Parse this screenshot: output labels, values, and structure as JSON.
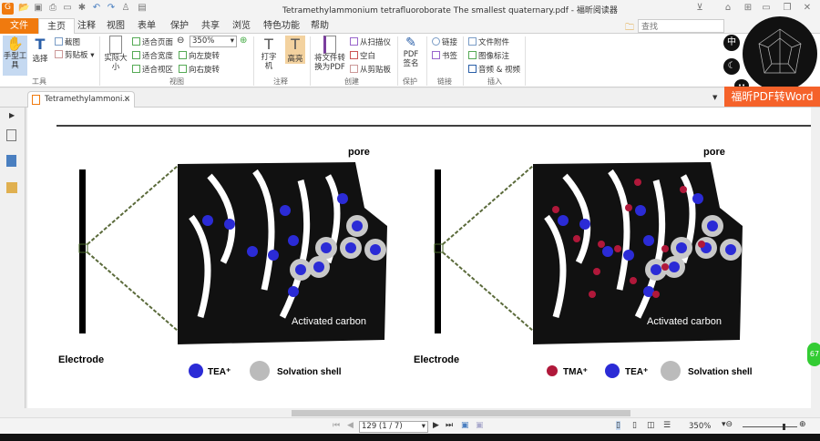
{
  "window": {
    "title": "Tetramethylammonium tetrafluoroborate The smallest quaternary.pdf - 福昕阅读器"
  },
  "menu": [
    "文件",
    "主页",
    "注释",
    "视图",
    "表单",
    "保护",
    "共享",
    "浏览",
    "特色功能",
    "帮助"
  ],
  "search": {
    "placeholder": "查找"
  },
  "ribbon": {
    "tools": {
      "hand": "手型工具",
      "select": "选择",
      "screenshot": "截图",
      "clipboard": "剪贴板",
      "group": "工具"
    },
    "view": {
      "actual": "实际大小",
      "fit_page": "适合页面",
      "fit_width": "适合宽度",
      "fit_visible": "适合视区",
      "zoom": "350%",
      "rotate_left": "向左旋转",
      "rotate_right": "向右旋转",
      "group": "视图"
    },
    "comment": {
      "typewriter": "打字机",
      "highlight": "高亮",
      "group": "注释"
    },
    "create": {
      "convert": "将文件转换为PDF",
      "scanner": "从扫描仪",
      "blank": "空白",
      "from_clipboard": "从剪贴板",
      "group": "创建"
    },
    "protect": {
      "sign": "PDF签名",
      "group": "保护"
    },
    "links": {
      "link": "链接",
      "bookmark": "书签",
      "group": "链接"
    },
    "insert": {
      "attach": "文件附件",
      "image": "图像标注",
      "av": "音频 & 视频",
      "group": "插入"
    }
  },
  "tab": {
    "label": "Tetramethylammoni..."
  },
  "widget": {
    "lang": "中",
    "ad": "福昕PDF转Word",
    "badge": "67"
  },
  "figure": {
    "pore": "pore",
    "carbon": "Activated carbon",
    "electrode": "Electrode",
    "tea": "TEA⁺",
    "tma": "TMA⁺",
    "shell": "Solvation shell"
  },
  "status": {
    "page": "129 (1 / 7)",
    "zoom": "350%",
    "zoom_level": 0.75
  },
  "colors": {
    "brand": "#f07a0e",
    "ad": "#f5622a",
    "tea": "#2b2bd6",
    "tma": "#b0183a"
  }
}
